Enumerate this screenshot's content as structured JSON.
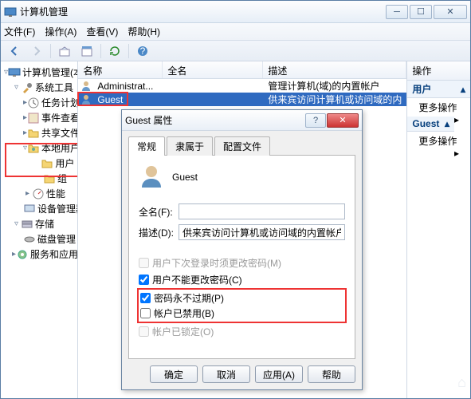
{
  "window": {
    "title": "计算机管理"
  },
  "menu": {
    "file": "文件(F)",
    "action": "操作(A)",
    "view": "查看(V)",
    "help": "帮助(H)"
  },
  "tree": {
    "root": "计算机管理(本地)",
    "system_tools": "系统工具",
    "task_scheduler": "任务计划程序",
    "event_viewer": "事件查看器",
    "shared_folders": "共享文件夹",
    "local_users_groups": "本地用户和组",
    "users": "用户",
    "groups": "组",
    "performance": "性能",
    "device_manager": "设备管理器",
    "storage": "存储",
    "disk_mgmt": "磁盘管理",
    "services_apps": "服务和应用程序"
  },
  "list": {
    "col_name": "名称",
    "col_fullname": "全名",
    "col_desc": "描述",
    "rows": [
      {
        "name": "Administrat...",
        "full": "",
        "desc": "管理计算机(域)的内置帐户"
      },
      {
        "name": "Guest",
        "full": "",
        "desc": "供来宾访问计算机或访问域的内"
      }
    ]
  },
  "actions": {
    "title": "操作",
    "section1": "用户",
    "more1": "更多操作",
    "section2": "Guest",
    "more2": "更多操作"
  },
  "dialog": {
    "title": "Guest 属性",
    "tab_general": "常规",
    "tab_member": "隶属于",
    "tab_profile": "配置文件",
    "username": "Guest",
    "fullname_label": "全名(F):",
    "fullname_value": "",
    "desc_label": "描述(D):",
    "desc_value": "供来宾访问计算机或访问域的内置帐户",
    "chk_must_change": "用户下次登录时须更改密码(M)",
    "chk_cannot_change": "用户不能更改密码(C)",
    "chk_never_expire": "密码永不过期(P)",
    "chk_disabled": "帐户已禁用(B)",
    "chk_locked": "帐户已锁定(O)",
    "btn_ok": "确定",
    "btn_cancel": "取消",
    "btn_apply": "应用(A)",
    "btn_help": "帮助"
  }
}
